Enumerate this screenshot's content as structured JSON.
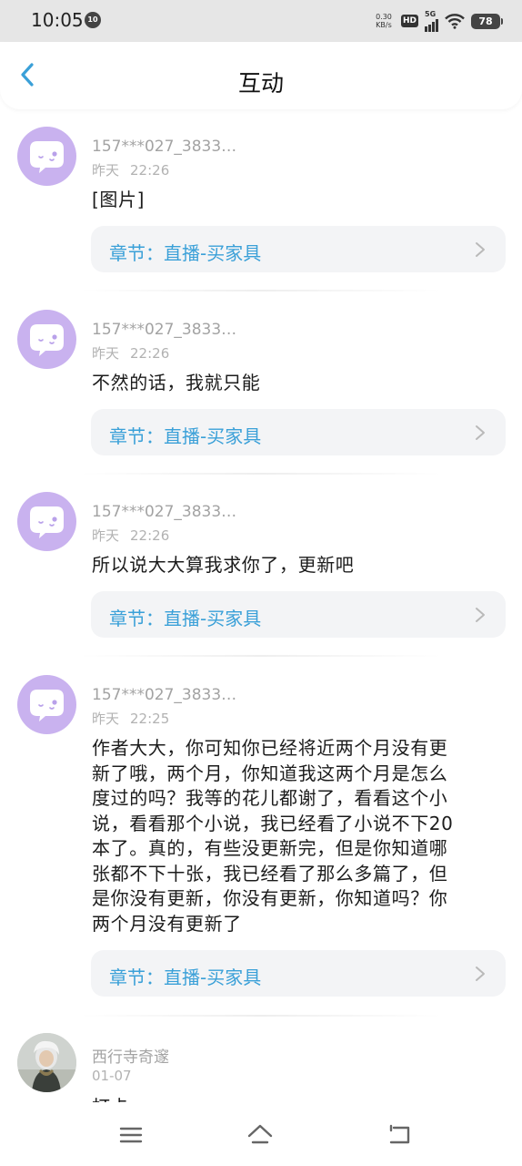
{
  "status_bar": {
    "time": "10:05",
    "notification_badge": "10",
    "net_speed_value": "0.30",
    "net_speed_unit": "KB/s",
    "hd_label": "HD",
    "network_type": "5G",
    "battery": "78"
  },
  "header": {
    "title": "互动",
    "back_icon": "chevron-left-icon"
  },
  "comments": [
    {
      "username": "157***027_3833…",
      "date": "昨天",
      "time": "22:26",
      "text": "[图片]",
      "chapter": "章节：直播-买家具"
    },
    {
      "username": "157***027_3833…",
      "date": "昨天",
      "time": "22:26",
      "text": "不然的话，我就只能",
      "chapter": "章节：直播-买家具"
    },
    {
      "username": "157***027_3833…",
      "date": "昨天",
      "time": "22:26",
      "text": "所以说大大算我求你了，更新吧",
      "chapter": "章节：直播-买家具"
    },
    {
      "username": "157***027_3833…",
      "date": "昨天",
      "time": "22:25",
      "lines": [
        "作者大大，你可知你已经将近两个月没有更",
        "新了哦，两个月，你知道我这两个月是怎么",
        "度过的吗？我等的花儿都谢了，看看这个小",
        "说，看看那个小说，我已经看了小说不下20",
        "本了。真的，有些没更新完，但是你知道哪",
        "张都不下十张，我已经看了那么多篇了，但",
        "是你没有更新，你没有更新，你知道吗？你",
        "两个月没有更新了"
      ],
      "chapter": "章节：直播-买家具"
    },
    {
      "username": "西行寺奇邃",
      "date": "01-07",
      "text": "打卡"
    }
  ],
  "nav_bar": {
    "menu_icon": "menu-icon",
    "home_icon": "home-icon",
    "back_icon": "back-icon"
  },
  "colors": {
    "accent": "#3aa0d8",
    "avatar_bg": "#c9b2ef",
    "chapter_bg": "#f3f4f6"
  }
}
